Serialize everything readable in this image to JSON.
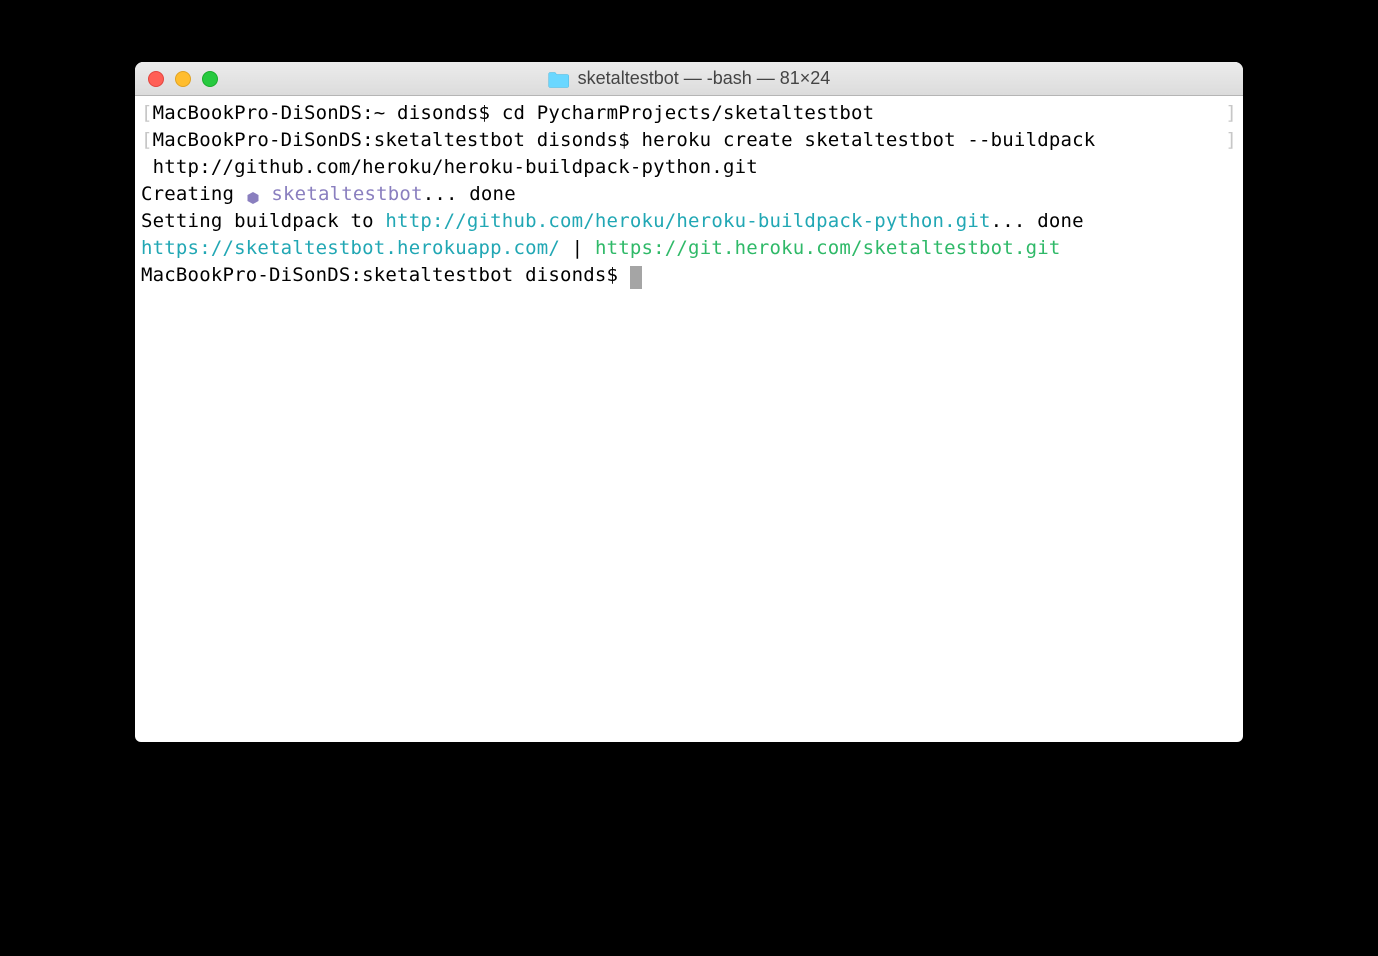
{
  "window": {
    "title": "sketaltestbot — -bash — 81×24"
  },
  "terminal": {
    "line1": {
      "bracket_open": "[",
      "prompt_host": "MacBookPro-DiSonDS:~ disonds$ ",
      "command": "cd PycharmProjects/sketaltestbot",
      "bracket_close": "]"
    },
    "line2": {
      "bracket_open": "[",
      "prompt_host": "MacBookPro-DiSonDS:sketaltestbot disonds$ ",
      "command": "heroku create sketaltestbot --buildpack",
      "bracket_close": "]"
    },
    "line3": {
      "text": " http://github.com/heroku/heroku-buildpack-python.git"
    },
    "line4": {
      "prefix": "Creating ",
      "app_name": "sketaltestbot",
      "suffix": "... done"
    },
    "line5": {
      "prefix": "Setting buildpack to ",
      "url": "http://github.com/heroku/heroku-buildpack-python.git",
      "suffix": "... done"
    },
    "line6": {
      "url1": "https://sketaltestbot.herokuapp.com/",
      "separator": " | ",
      "url2": "https://git.heroku.com/sketaltestbot.git"
    },
    "line7": {
      "prompt": "MacBookPro-DiSonDS:sketaltestbot disonds$ "
    }
  }
}
